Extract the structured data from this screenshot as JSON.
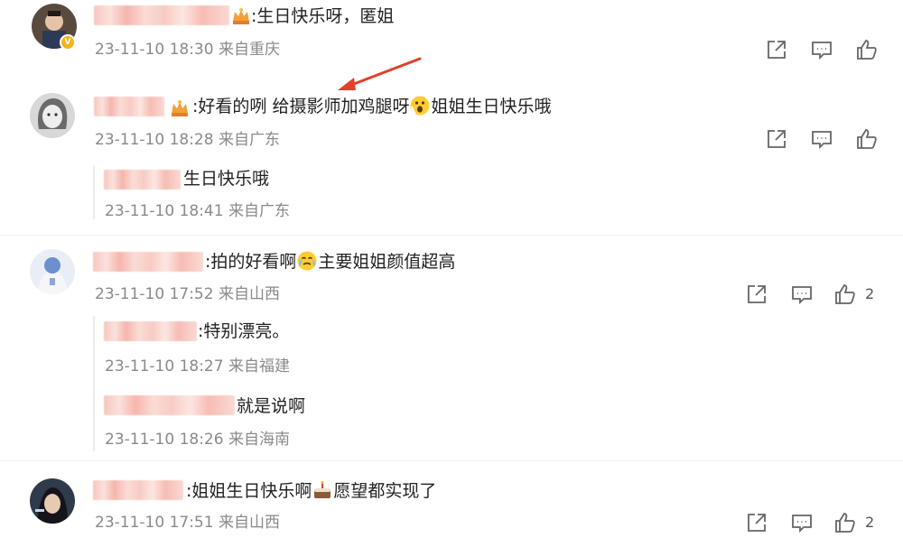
{
  "comments": [
    {
      "text": ":生日快乐呀，匿姐",
      "time": "23-11-10 18:30 来自重庆",
      "likes": ""
    },
    {
      "text_a": ":好看的咧 给摄影师加鸡腿呀",
      "text_b": "姐姐生日快乐哦",
      "time": "23-11-10 18:28 来自广东",
      "likes": "",
      "replies": [
        {
          "text": "生日快乐哦",
          "time": "23-11-10 18:41 来自广东"
        }
      ]
    },
    {
      "text_a": ":拍的好看啊",
      "text_b": "主要姐姐颜值超高",
      "time": "23-11-10 17:52 来自山西",
      "likes": "2",
      "replies": [
        {
          "text": ":特别漂亮。",
          "time": "23-11-10 18:27 来自福建"
        },
        {
          "text": "就是说啊",
          "time": "23-11-10 18:26 来自海南"
        }
      ]
    },
    {
      "text_a": ":姐姐生日快乐啊",
      "text_b": "愿望都实现了",
      "time": "23-11-10 17:51 来自山西",
      "likes": "2"
    }
  ],
  "icons": {
    "share": "share-icon",
    "comment": "comment-icon",
    "like": "thumbs-up-icon",
    "crown": "crown-icon",
    "verified": "verified-badge-icon"
  },
  "colors": {
    "text": "#222222",
    "meta": "#8a8a8a",
    "annotation_arrow": "#e2402b",
    "badge": "#f5b21b"
  }
}
